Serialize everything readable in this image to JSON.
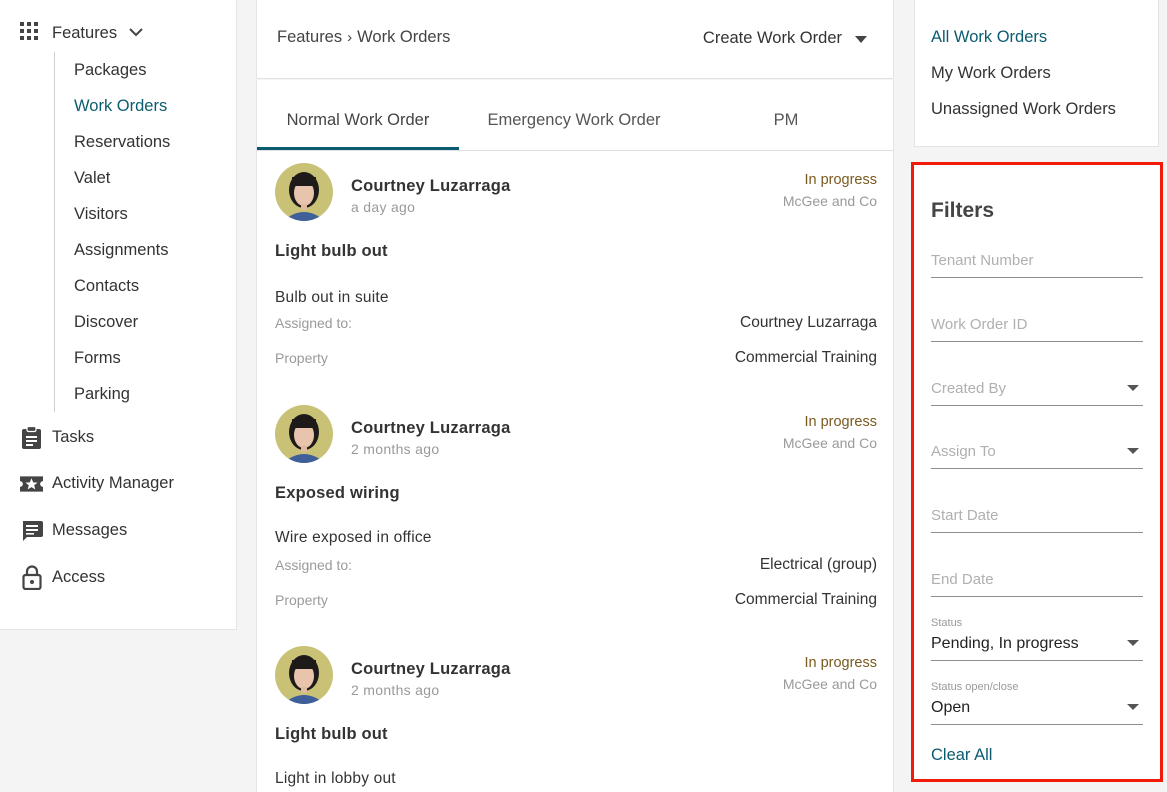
{
  "sidebar": {
    "features_label": "Features",
    "feature_items": [
      {
        "label": "Packages"
      },
      {
        "label": "Work Orders"
      },
      {
        "label": "Reservations"
      },
      {
        "label": "Valet"
      },
      {
        "label": "Visitors"
      },
      {
        "label": "Assignments"
      },
      {
        "label": "Contacts"
      },
      {
        "label": "Discover"
      },
      {
        "label": "Forms"
      },
      {
        "label": "Parking"
      }
    ],
    "active_item": "Work Orders",
    "main_items": [
      {
        "label": "Tasks",
        "icon": "clipboard-icon"
      },
      {
        "label": "Activity Manager",
        "icon": "star-ticket-icon"
      },
      {
        "label": "Messages",
        "icon": "chat-icon"
      },
      {
        "label": "Access",
        "icon": "lock-icon"
      }
    ]
  },
  "header": {
    "breadcrumb_root": "Features",
    "breadcrumb_current": "Work Orders",
    "create_label": "Create Work Order"
  },
  "tabs": [
    {
      "label": "Normal Work Order"
    },
    {
      "label": "Emergency Work Order"
    },
    {
      "label": "PM"
    }
  ],
  "active_tab": "Normal Work Order",
  "work_orders": [
    {
      "name": "Courtney Luzarraga",
      "time": "a day ago",
      "status": "In progress",
      "company": "McGee and Co",
      "title": "Light bulb out",
      "description": "Bulb out in suite",
      "assigned_label": "Assigned to:",
      "assigned_to": "Courtney Luzarraga",
      "property_label": "Property",
      "property": "Commercial Training"
    },
    {
      "name": "Courtney Luzarraga",
      "time": "2 months ago",
      "status": "In progress",
      "company": "McGee and Co",
      "title": "Exposed wiring",
      "description": "Wire exposed in office",
      "assigned_label": "Assigned to:",
      "assigned_to": "Electrical (group)",
      "property_label": "Property",
      "property": "Commercial Training"
    },
    {
      "name": "Courtney Luzarraga",
      "time": "2 months ago",
      "status": "In progress",
      "company": "McGee and Co",
      "title": "Light bulb out",
      "description": "Light in lobby out"
    }
  ],
  "views": [
    {
      "label": "All Work Orders"
    },
    {
      "label": "My Work Orders"
    },
    {
      "label": "Unassigned Work Orders"
    }
  ],
  "active_view": "All Work Orders",
  "filters": {
    "title": "Filters",
    "tenant_number_placeholder": "Tenant Number",
    "work_order_id_placeholder": "Work Order ID",
    "created_by_placeholder": "Created By",
    "assign_to_placeholder": "Assign To",
    "start_date_placeholder": "Start Date",
    "end_date_placeholder": "End Date",
    "status_label": "Status",
    "status_value": "Pending, In progress",
    "status_open_label": "Status open/close",
    "status_open_value": "Open",
    "clear_all": "Clear All"
  },
  "colors": {
    "accent": "#0c5c71",
    "status": "#7a5a1e",
    "highlight_border": "#f21b0a"
  }
}
